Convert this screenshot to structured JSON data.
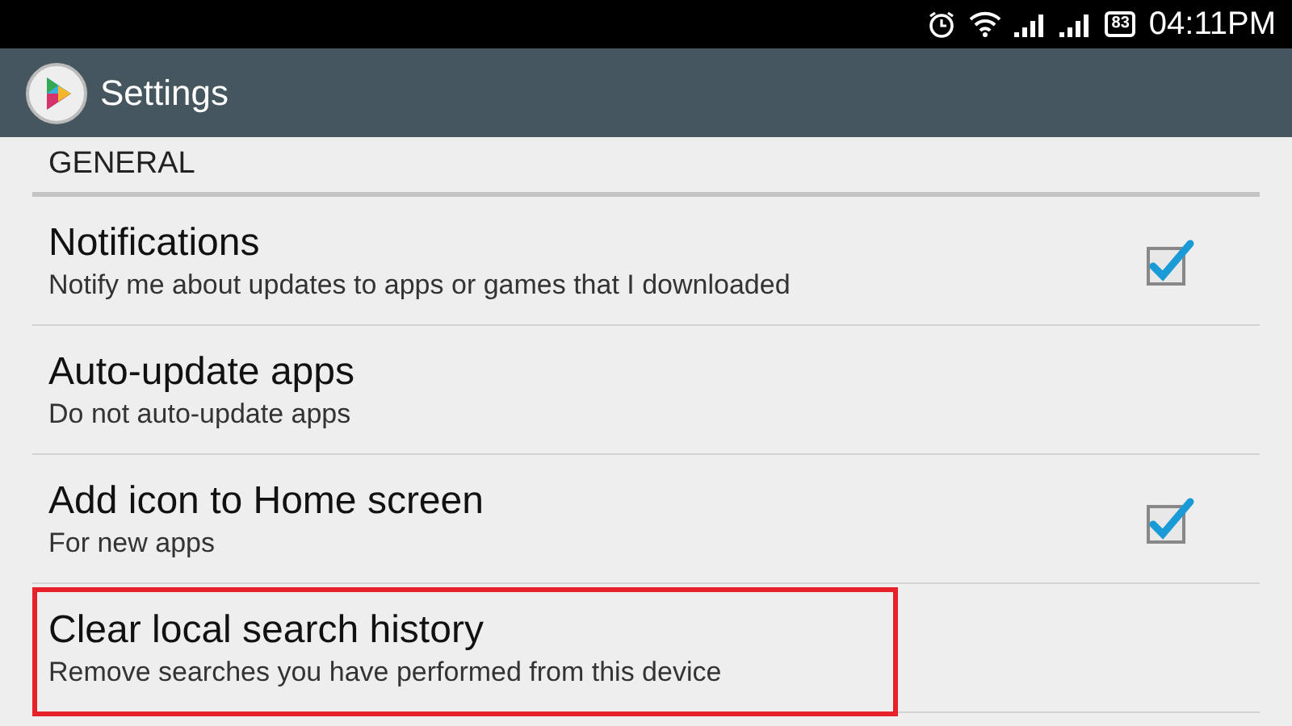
{
  "status_bar": {
    "battery": "83",
    "time": "04:11PM"
  },
  "action_bar": {
    "title": "Settings"
  },
  "section": {
    "title": "GENERAL"
  },
  "items": [
    {
      "kind": "checkbox",
      "title": "Notifications",
      "summary": "Notify me about updates to apps or games that I downloaded",
      "checked": true,
      "highlighted": false
    },
    {
      "kind": "plain",
      "title": "Auto-update apps",
      "summary": "Do not auto-update apps",
      "highlighted": false
    },
    {
      "kind": "checkbox",
      "title": "Add icon to Home screen",
      "summary": "For new apps",
      "checked": true,
      "highlighted": false
    },
    {
      "kind": "plain",
      "title": "Clear local search history",
      "summary": "Remove searches you have performed from this device",
      "highlighted": true
    }
  ]
}
